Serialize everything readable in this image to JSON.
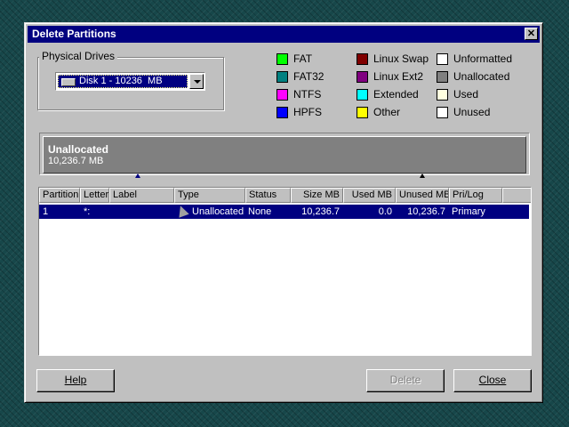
{
  "dialog": {
    "title": "Delete Partitions"
  },
  "physical_drives": {
    "label": "Physical Drives",
    "selected": "Disk 1 - 10236  MB"
  },
  "legend": [
    {
      "label": "FAT",
      "color": "#00ff00"
    },
    {
      "label": "FAT32",
      "color": "#008080"
    },
    {
      "label": "NTFS",
      "color": "#ff00ff"
    },
    {
      "label": "HPFS",
      "color": "#0000ff"
    },
    {
      "label": "Linux Swap",
      "color": "#800000"
    },
    {
      "label": "Linux Ext2",
      "color": "#800080"
    },
    {
      "label": "Extended",
      "color": "#00ffff"
    },
    {
      "label": "Other",
      "color": "#ffff00"
    },
    {
      "label": "Unformatted",
      "color": "#ffffff"
    },
    {
      "label": "Unallocated",
      "color": "#808080"
    },
    {
      "label": "Used",
      "color": "#ffffe0"
    },
    {
      "label": "Unused",
      "color": "#ffffff"
    }
  ],
  "partition_bar": {
    "name": "Unallocated",
    "size": "10,236.7 MB"
  },
  "table": {
    "columns": [
      "Partition",
      "Letter",
      "Label",
      "Type",
      "Status",
      "Size MB",
      "Used MB",
      "Unused MB",
      "Pri/Log"
    ],
    "rows": [
      {
        "partition": "1",
        "letter": "*:",
        "label": "",
        "type": "Unallocated",
        "status": "None",
        "size": "10,236.7",
        "used": "0.0",
        "unused": "10,236.7",
        "prilog": "Primary"
      }
    ]
  },
  "buttons": {
    "help": "Help",
    "delete": "Delete",
    "close": "Close"
  }
}
